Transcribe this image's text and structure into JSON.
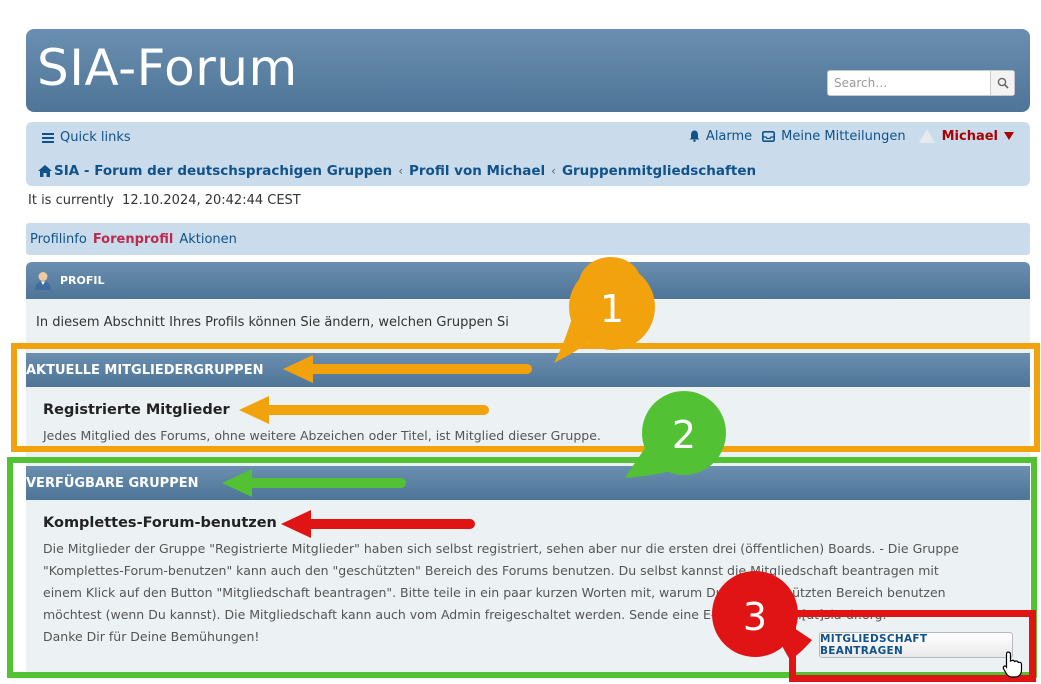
{
  "header": {
    "site_title": "SIA-Forum",
    "search_placeholder": "Search…"
  },
  "navbar": {
    "quick_links": "Quick links",
    "alarms": "Alarme",
    "messages": "Meine Mitteilungen",
    "username": "Michael",
    "breadcrumbs": [
      "SIA - Forum der deutschsprachigen Gruppen",
      "Profil von Michael",
      "Gruppenmitgliedschaften"
    ]
  },
  "current_time": "It is currently  12.10.2024, 20:42:44 CEST",
  "tabs": [
    "Profilinfo",
    "Forenprofil",
    "Aktionen"
  ],
  "active_tab": "Forenprofil",
  "panel": {
    "header": "PROFIL",
    "intro": "In diesem Abschnitt Ihres Profils können Sie ändern, welchen Gruppen Si"
  },
  "current_groups": {
    "header": "AKTUELLE MITGLIEDERGRUPPEN",
    "group_name": "Registrierte Mitglieder",
    "group_desc": "Jedes Mitglied des Forums, ohne weitere Abzeichen oder Titel, ist Mitglied dieser Gruppe."
  },
  "available_groups": {
    "header": "VERFÜGBARE GRUPPEN",
    "group_name": "Komplettes-Forum-benutzen",
    "desc_lines": [
      "Die Mitglieder der Gruppe \"Registrierte Mitglieder\" haben sich selbst registriert, sehen aber nur die ersten drei (öffentlichen) Boards. - Die Gruppe",
      "\"Komplettes-Forum-benutzen\" kann auch den \"geschützten\" Bereich des Forums benutzen. Du selbst kannst die Mitgliedschaft beantragen mit",
      "einem Klick auf den Button \"Mitgliedschaft beantragen\". Bitte teile in ein paar kurzen Worten mit, warum Du den geschützten Bereich benutzen",
      "möchtest (wenn Du kannst). Die Mitgliedschaft kann auch vom Admin freigeschaltet werden. Sende eine E-Mail an forum[at]sia-dr.org. -",
      "Danke Dir für Deine Bemühungen!"
    ],
    "join_button": "MITGLIEDSCHAFT BEANTRAGEN"
  },
  "annotations": {
    "markers": [
      "1",
      "2",
      "3"
    ],
    "colors": {
      "orange": "#f2a20d",
      "green": "#52c234",
      "red": "#e01414"
    }
  }
}
